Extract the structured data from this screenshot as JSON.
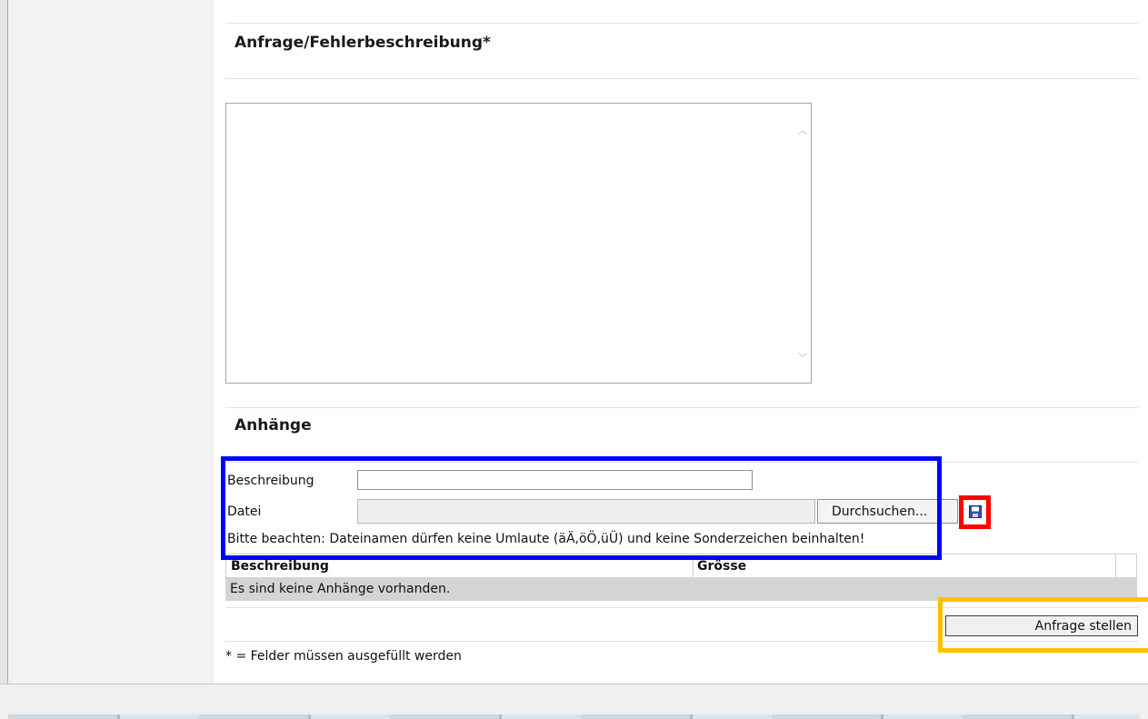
{
  "form": {
    "description_heading": "Anfrage/Fehlerbeschreibung*",
    "description_value": "",
    "attachments_heading": "Anhänge",
    "desc_label": "Beschreibung",
    "desc_value": "",
    "file_label": "Datei",
    "browse_label": "Durchsuchen...",
    "note": "Bitte beachten: Dateinamen dürfen keine Umlaute (äÄ,öÖ,üÜ) und keine Sonderzeichen beinhalten!",
    "submit_label": "Anfrage stellen",
    "required_note": "* = Felder müssen ausgefüllt werden"
  },
  "attachments_table": {
    "headers": [
      "Beschreibung",
      "Grösse"
    ],
    "empty_message": "Es sind keine Anhänge vorhanden."
  },
  "icons": {
    "save": "save-icon",
    "scroll_up": "chevron-up-icon",
    "scroll_down": "chevron-down-icon"
  },
  "colors": {
    "highlight_blue": "#0000ff",
    "highlight_red": "#ff0000",
    "highlight_orange": "#ffc000"
  }
}
